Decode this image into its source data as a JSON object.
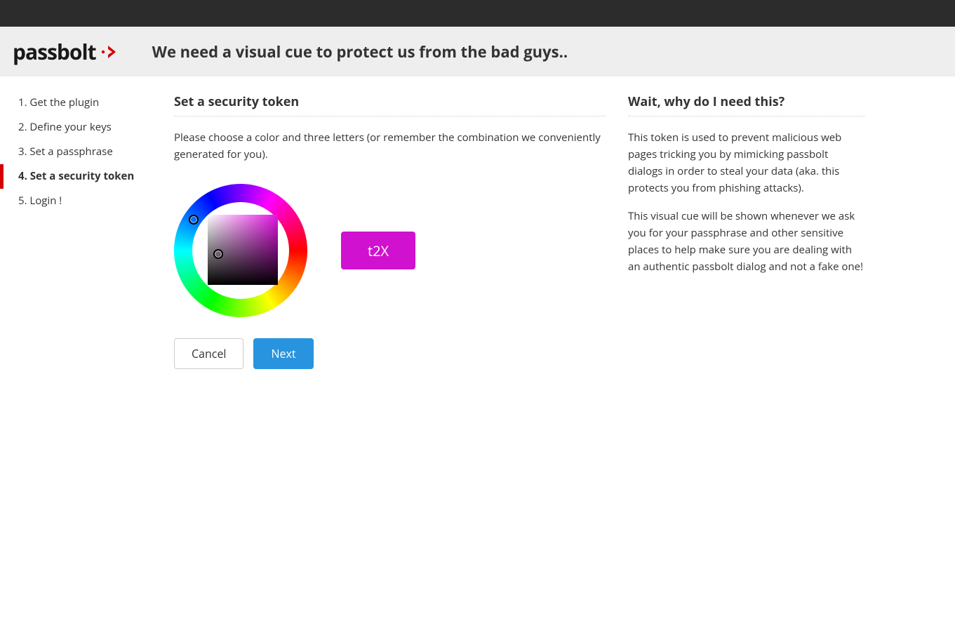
{
  "logo_text": "passbolt",
  "header": {
    "title": "We need a visual cue to protect us from the bad guys.."
  },
  "sidebar": {
    "items": [
      {
        "label": "1. Get the plugin",
        "active": false
      },
      {
        "label": "2. Define your keys",
        "active": false
      },
      {
        "label": "3. Set a passphrase",
        "active": false
      },
      {
        "label": "4. Set a security token",
        "active": true
      },
      {
        "label": "5. Login !",
        "active": false
      }
    ]
  },
  "main": {
    "title": "Set a security token",
    "instruction": "Please choose a color and three letters (or remember the combination we conveniently generated for you).",
    "token_value": "t2X",
    "token_color": "#d011cf",
    "cancel_label": "Cancel",
    "next_label": "Next"
  },
  "aside": {
    "title": "Wait, why do I need this?",
    "p1": "This token is used to prevent malicious web pages tricking you by mimicking passbolt dialogs in order to steal your data (aka. this protects you from phishing attacks).",
    "p2": "This visual cue will be shown whenever we ask you for your passphrase and other sensitive places to help make sure you are dealing with an authentic passbolt dialog and not a fake one!"
  }
}
